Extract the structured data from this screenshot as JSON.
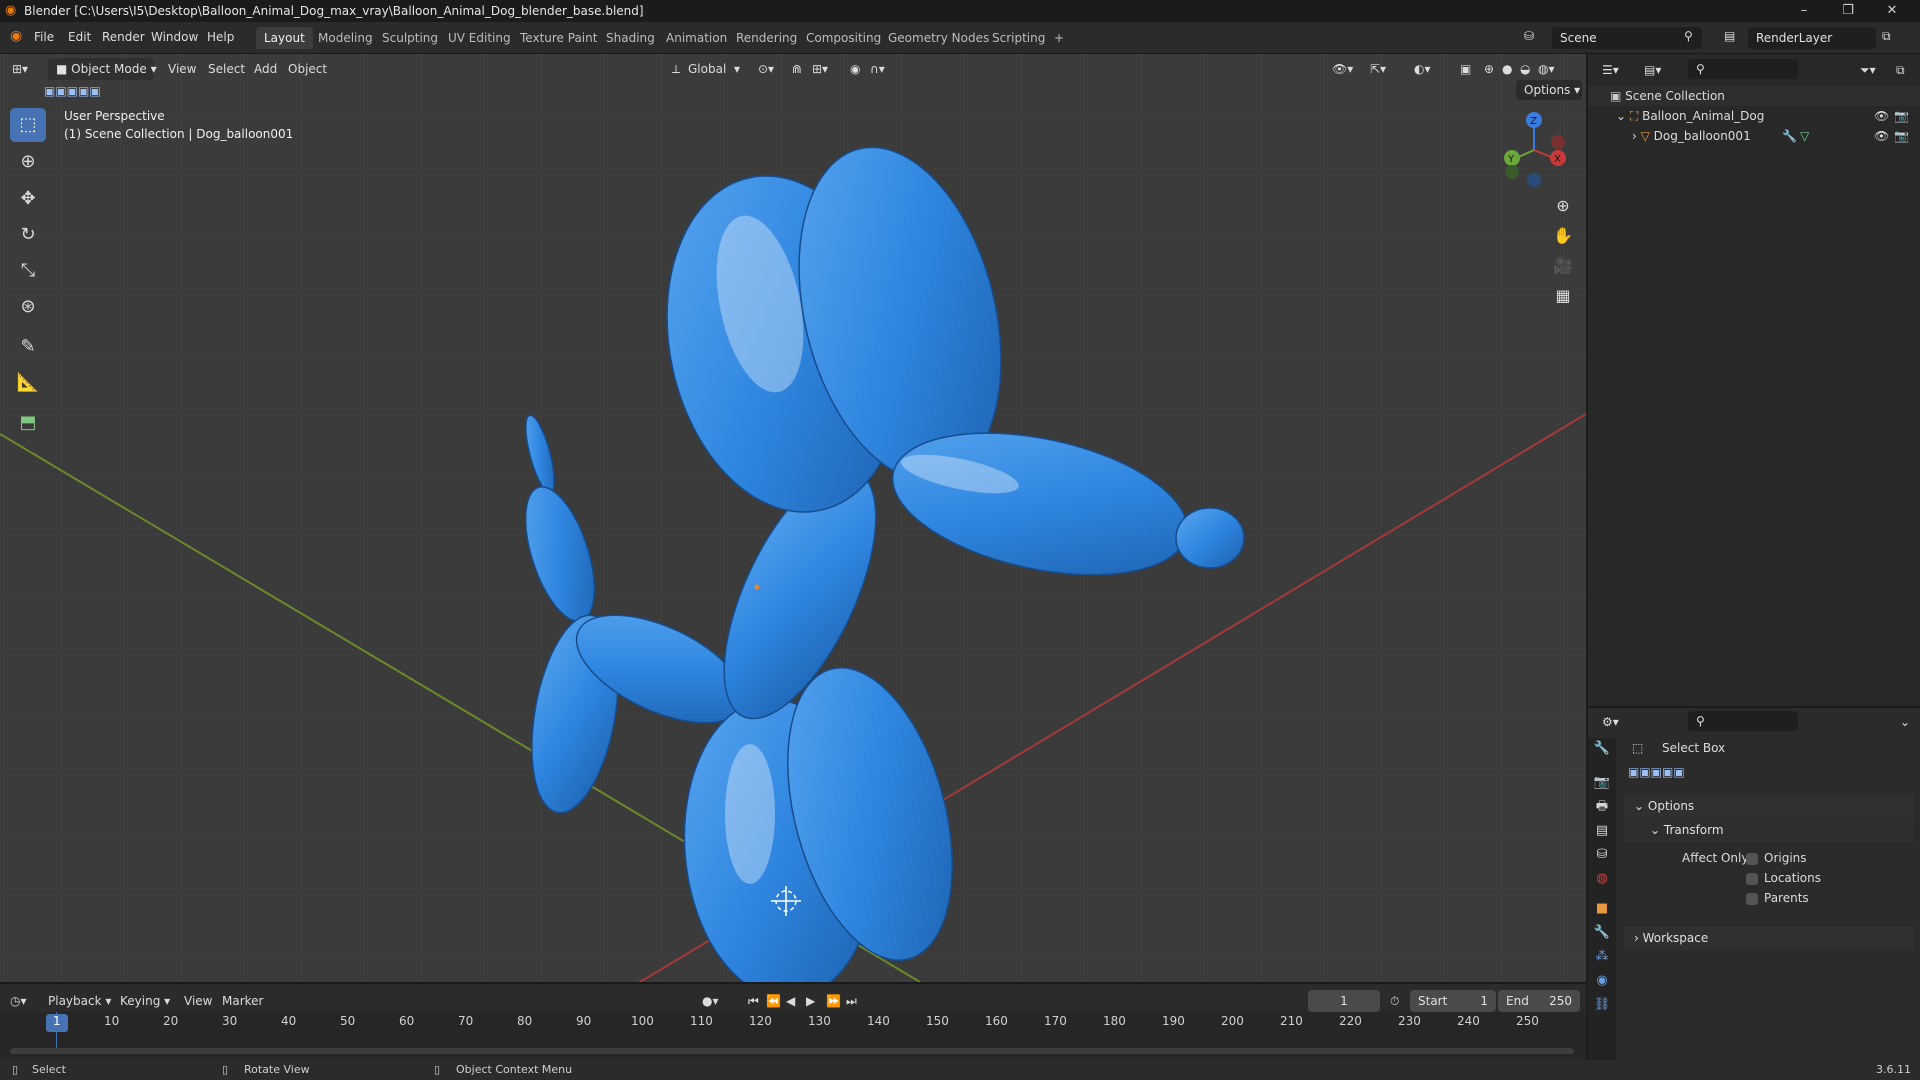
{
  "window": {
    "title": "Blender [C:\\Users\\I5\\Desktop\\Balloon_Animal_Dog_max_vray\\Balloon_Animal_Dog_blender_base.blend]",
    "controls": [
      "–",
      "❐",
      "✕"
    ]
  },
  "menu": [
    "File",
    "Edit",
    "Render",
    "Window",
    "Help"
  ],
  "workspaces": [
    "Layout",
    "Modeling",
    "Sculpting",
    "UV Editing",
    "Texture Paint",
    "Shading",
    "Animation",
    "Rendering",
    "Compositing",
    "Geometry Nodes",
    "Scripting"
  ],
  "add_workspace": "+",
  "scene": {
    "name": "Scene",
    "render_layer": "RenderLayer"
  },
  "viewport": {
    "mode": "Object Mode",
    "menus": [
      "View",
      "Select",
      "Add",
      "Object"
    ],
    "orientation": "Global",
    "options_label": "Options",
    "perspective": "User Perspective",
    "collection_info": "(1) Scene Collection | Dog_balloon001",
    "axes": {
      "z": "Z",
      "y": "Y",
      "x": "X"
    },
    "colors": {
      "balloon": "#2f86e0",
      "grid_x": "#a53a3a",
      "grid_y": "#6a8a2a",
      "background": "#3b3b3b"
    }
  },
  "outliner": {
    "root": "Scene Collection",
    "collection": "Balloon_Animal_Dog",
    "object": "Dog_balloon001"
  },
  "properties": {
    "tool_name": "Select Box",
    "options_label": "Options",
    "transform_label": "Transform",
    "affect_only_label": "Affect Only",
    "checks": [
      "Origins",
      "Locations",
      "Parents"
    ],
    "workspace_label": "Workspace"
  },
  "timeline": {
    "menus": [
      "Playback",
      "Keying",
      "View",
      "Marker"
    ],
    "current_frame": "1",
    "start_label": "Start",
    "start": "1",
    "end_label": "End",
    "end": "250",
    "ticks": [
      "1",
      "10",
      "20",
      "30",
      "40",
      "50",
      "60",
      "70",
      "80",
      "90",
      "100",
      "110",
      "120",
      "130",
      "140",
      "150",
      "160",
      "170",
      "180",
      "190",
      "200",
      "210",
      "220",
      "230",
      "240",
      "250"
    ]
  },
  "status": {
    "select": "Select",
    "rotate": "Rotate View",
    "context": "Object Context Menu",
    "version": "3.6.11"
  }
}
